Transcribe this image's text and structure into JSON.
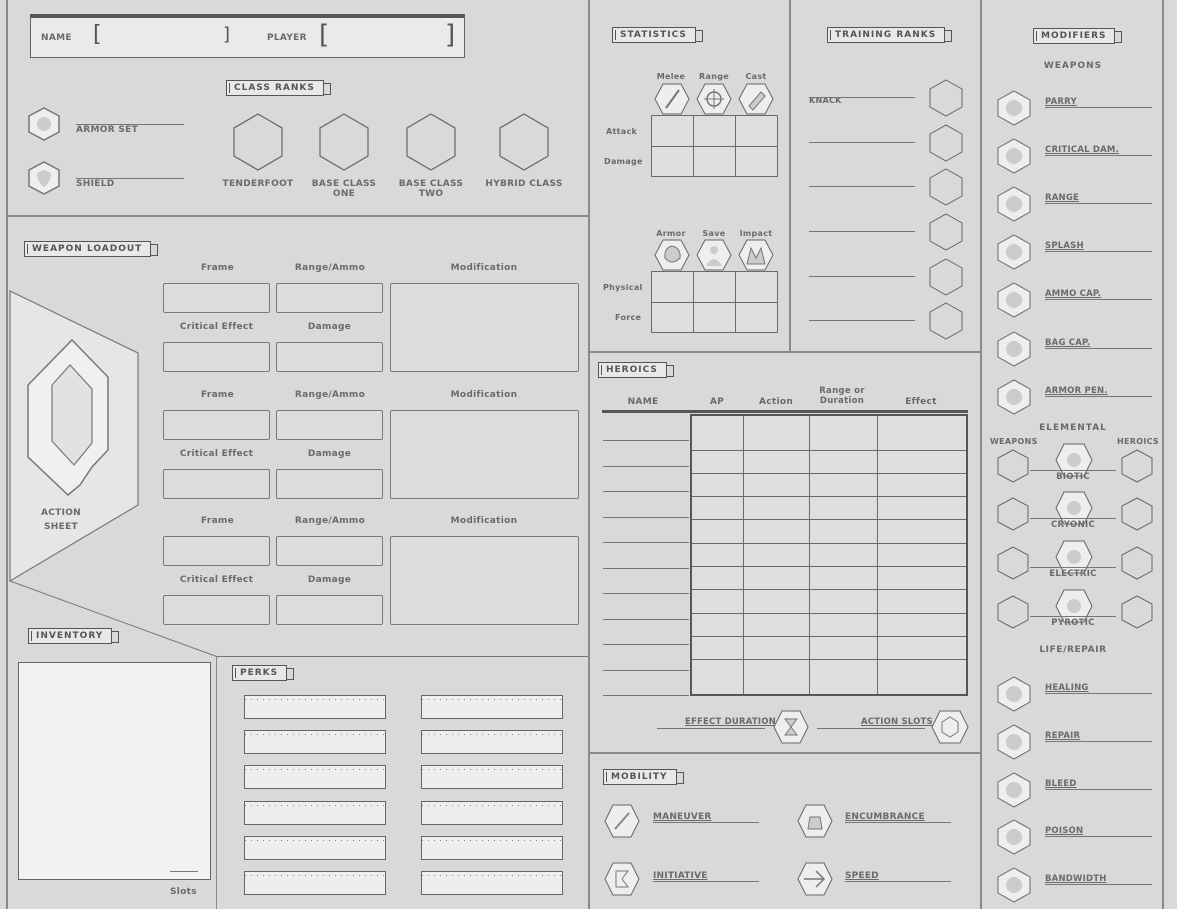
{
  "header": {
    "name_label": "NAME",
    "player_label": "PLAYER"
  },
  "class_ranks": {
    "title": "CLASS RANKS",
    "armor_set": "ARMOR SET",
    "shield": "SHIELD",
    "ranks": [
      "TENDERFOOT",
      "BASE CLASS ONE",
      "BASE CLASS TWO",
      "HYBRID CLASS"
    ]
  },
  "weapon_loadout": {
    "title": "WEAPON LOADOUT",
    "frame": "Frame",
    "range_ammo": "Range/Ammo",
    "modification": "Modification",
    "critical_effect": "Critical Effect",
    "damage": "Damage",
    "action_sheet": "ACTION SHEET"
  },
  "inventory": {
    "title": "INVENTORY",
    "slots": "Slots"
  },
  "perks": {
    "title": "PERKS"
  },
  "statistics": {
    "title": "STATISTICS",
    "top_cols": [
      "Melee",
      "Range",
      "Cast"
    ],
    "top_rows": [
      "Attack",
      "Damage"
    ],
    "bottom_cols": [
      "Armor",
      "Save",
      "Impact"
    ],
    "bottom_rows": [
      "Physical",
      "Force"
    ]
  },
  "training_ranks": {
    "title": "TRAINING RANKS",
    "knack": "KNACK"
  },
  "heroics": {
    "title": "HEROICS",
    "cols": [
      "NAME",
      "AP",
      "Action",
      "Range or Duration",
      "Effect"
    ],
    "effect_duration": "EFFECT DURATION",
    "action_slots": "ACTION SLOTS"
  },
  "mobility": {
    "title": "MOBILITY",
    "items": [
      "MANEUVER",
      "ENCUMBRANCE",
      "INITIATIVE",
      "SPEED"
    ]
  },
  "modifiers": {
    "title": "MODIFIERS",
    "weapons_heading": "WEAPONS",
    "weapon_items": [
      "PARRY",
      "CRITICAL DAM.",
      "RANGE",
      "SPLASH",
      "AMMO CAP.",
      "BAG CAP.",
      "ARMOR PEN."
    ],
    "elemental_heading": "ELEMENTAL",
    "weapons_col": "WEAPONS",
    "heroics_col": "HEROICS",
    "elements": [
      "BIOTIC",
      "CRYONIC",
      "ELECTRIC",
      "PYROTIC"
    ],
    "life_heading": "LIFE/REPAIR",
    "life_items": [
      "HEALING",
      "REPAIR",
      "BLEED",
      "POISON",
      "BANDWIDTH"
    ]
  }
}
